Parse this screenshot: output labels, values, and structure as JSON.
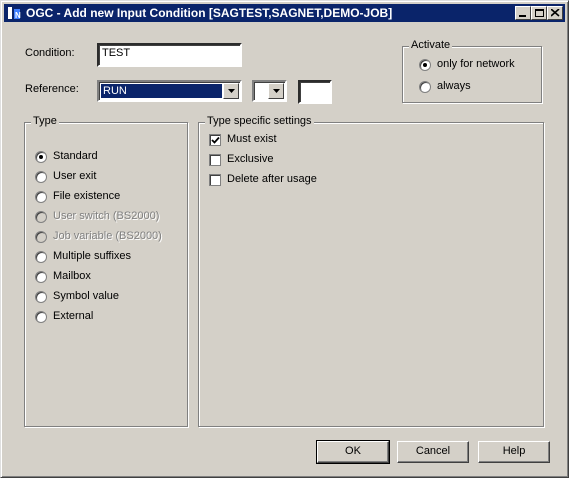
{
  "window": {
    "title": "OGC - Add new Input Condition [SAGTEST,SAGNET,DEMO-JOB]",
    "controls": [
      "minimize-icon",
      "maximize-icon",
      "close-icon"
    ]
  },
  "form": {
    "condition_label": "Condition:",
    "condition_value": "TEST",
    "reference_label": "Reference:",
    "reference_value": "RUN",
    "reference2_value": "",
    "reference3_value": ""
  },
  "activate": {
    "title": "Activate",
    "options": [
      {
        "label": "only for network",
        "selected": true
      },
      {
        "label": "always",
        "selected": false
      }
    ]
  },
  "type": {
    "title": "Type",
    "options": [
      {
        "label": "Standard",
        "selected": true,
        "enabled": true
      },
      {
        "label": "User exit",
        "selected": false,
        "enabled": true
      },
      {
        "label": "File existence",
        "selected": false,
        "enabled": true
      },
      {
        "label": "User switch (BS2000)",
        "selected": false,
        "enabled": false
      },
      {
        "label": "Job variable (BS2000)",
        "selected": false,
        "enabled": false
      },
      {
        "label": "Multiple suffixes",
        "selected": false,
        "enabled": true
      },
      {
        "label": "Mailbox",
        "selected": false,
        "enabled": true
      },
      {
        "label": "Symbol value",
        "selected": false,
        "enabled": true
      },
      {
        "label": "External",
        "selected": false,
        "enabled": true
      }
    ]
  },
  "settings": {
    "title": "Type specific settings",
    "checks": [
      {
        "label": "Must exist",
        "checked": true
      },
      {
        "label": "Exclusive",
        "checked": false
      },
      {
        "label": "Delete after usage",
        "checked": false
      }
    ]
  },
  "buttons": {
    "ok": "OK",
    "cancel": "Cancel",
    "help": "Help"
  },
  "colors": {
    "titlebar": "#0a246a",
    "face": "#d4d0c8",
    "selection": "#0a246a"
  }
}
